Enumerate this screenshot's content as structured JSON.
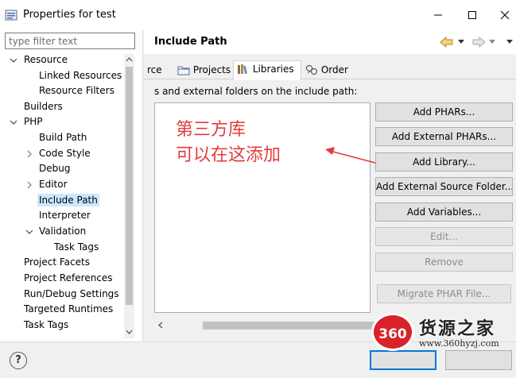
{
  "window": {
    "title": "Properties for test"
  },
  "filter": {
    "placeholder": "type filter text"
  },
  "tree": {
    "items": [
      {
        "label": "Resource",
        "twisty": "expanded"
      },
      {
        "label": "Linked Resources"
      },
      {
        "label": "Resource Filters"
      },
      {
        "label": "Builders"
      },
      {
        "label": "PHP",
        "twisty": "expanded"
      },
      {
        "label": "Build Path"
      },
      {
        "label": "Code Style",
        "twisty": "collapsed"
      },
      {
        "label": "Debug"
      },
      {
        "label": "Editor",
        "twisty": "collapsed"
      },
      {
        "label": "Include Path",
        "selected": true
      },
      {
        "label": "Interpreter"
      },
      {
        "label": "Validation",
        "twisty": "expanded"
      },
      {
        "label": "Task Tags"
      },
      {
        "label": "Project Facets"
      },
      {
        "label": "Project References"
      },
      {
        "label": "Run/Debug Settings"
      },
      {
        "label": "Targeted Runtimes"
      },
      {
        "label": "Task Tags"
      }
    ]
  },
  "page": {
    "title": "Include Path",
    "tabs": [
      {
        "label": "rce",
        "icon": "source-folder-icon"
      },
      {
        "label": "Projects",
        "icon": "projects-icon"
      },
      {
        "label": "Libraries",
        "icon": "libraries-icon",
        "active": true
      },
      {
        "label": "Order",
        "icon": "order-icon"
      }
    ],
    "description": "s and external folders on the include path:",
    "annotation": {
      "line1": "第三方库",
      "line2": "可以在这添加",
      "color": "#e53a3a"
    },
    "buttons": {
      "add_phars": "Add PHARs...",
      "add_external_phars": "Add External PHARs...",
      "add_library": "Add Library...",
      "add_external_source_folder": "Add External Source Folder...",
      "add_variables": "Add Variables...",
      "edit": "Edit...",
      "remove": "Remove",
      "migrate_phar": "Migrate PHAR File..."
    }
  },
  "bottom": {
    "help": "?"
  },
  "watermark": {
    "logo": "360",
    "name": "货源之家",
    "url": "www.360hyzj.com"
  },
  "colors": {
    "selection": "#cce8ff",
    "accent": "#0078d7",
    "annotation": "#e53a3a"
  }
}
